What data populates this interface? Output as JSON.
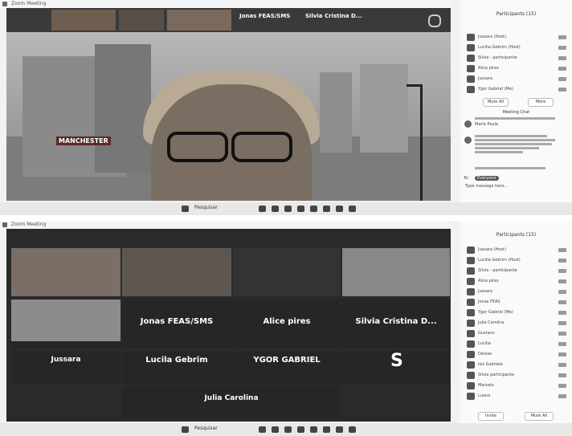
{
  "top": {
    "window_title": "Zoom Meeting",
    "strip_name": "Jonas FEAS/SMS",
    "strip_name2": "Silvia Cristina D...",
    "sign_text": "MANCHESTER",
    "taskbar_search": "Pesquisar",
    "panel": {
      "title": "Participants (15)",
      "find_placeholder": "Find a participant",
      "rows": [
        "Jussara (Host)",
        "Lucilia Gebrim (Host)",
        "Silvia - participante",
        "Alice pires",
        "Jussara",
        "Ygor Gabriel (Me)"
      ],
      "btn_mute": "Mute All",
      "btn_more": "More",
      "chat_title": "Meeting Chat",
      "msg_name": "Maria Paula",
      "chat_placeholder": "Type message here...",
      "chip": "Everyone",
      "to_label": "To:"
    }
  },
  "bottom": {
    "window_title": "Zoom Meeting",
    "tiles": [
      "Jonas FEAS/SMS",
      "Alice pires",
      "Silvia Cristina D...",
      "Jussara",
      "Lucila Gebrim",
      "YGOR GABRIEL",
      "S",
      "Julia Carolina"
    ],
    "taskbar_search": "Pesquisar",
    "panel": {
      "title": "Participants (15)",
      "rows": [
        "Jussara (Host)",
        "Lucilia Gebrim (Host)",
        "Silvia - participante",
        "Alice pires",
        "Jussara",
        "Jonas FEAS",
        "Ygor Gabriel (Me)",
        "Julia Carolina",
        "Gustavo",
        "Lucilia",
        "Denise",
        "Isis Gabriela",
        "Silvia participante",
        "Marcelo",
        "Luana"
      ],
      "btn_invite": "Invite",
      "btn_mute": "Mute All"
    }
  }
}
